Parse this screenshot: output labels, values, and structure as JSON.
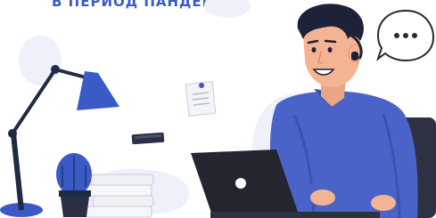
{
  "banner": {
    "title": "В ПЕРИОД ПАНДЕМИИ"
  },
  "illustration": {
    "speech_bubble_icon": "ellipsis-icon",
    "colors": {
      "accent_blue": "#3a5bc7",
      "shirt_blue": "#4a63c9",
      "skin": "#f4b392",
      "hair": "#1e2238",
      "laptop": "#23262f",
      "blob": "#eef1fa"
    }
  }
}
